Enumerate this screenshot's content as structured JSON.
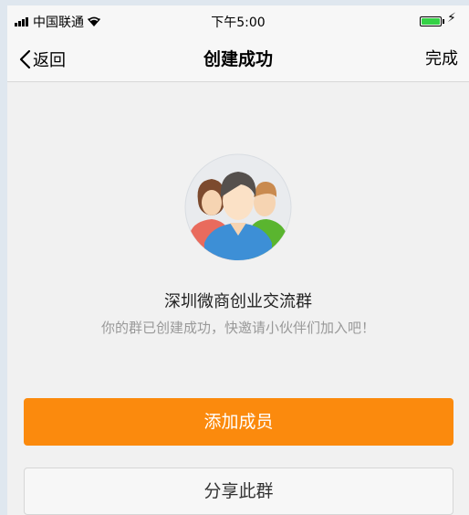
{
  "status_bar": {
    "carrier": "中国联通",
    "time": "下午5:00",
    "charging_symbol": "⚡"
  },
  "nav": {
    "back_label": "返回",
    "title": "创建成功",
    "done_label": "完成"
  },
  "group": {
    "name": "深圳微商创业交流群",
    "subtitle": "你的群已创建成功，快邀请小伙伴们加入吧！"
  },
  "actions": {
    "add_members": "添加成员",
    "share_group": "分享此群"
  },
  "colors": {
    "accent": "#fb8a0d",
    "background": "#f1f1f1",
    "battery": "#35d246"
  },
  "icons": {
    "back": "chevron-left-icon",
    "group_avatar": "group-avatar-icon",
    "signal": "signal-icon",
    "wifi": "wifi-icon",
    "battery": "battery-icon"
  }
}
